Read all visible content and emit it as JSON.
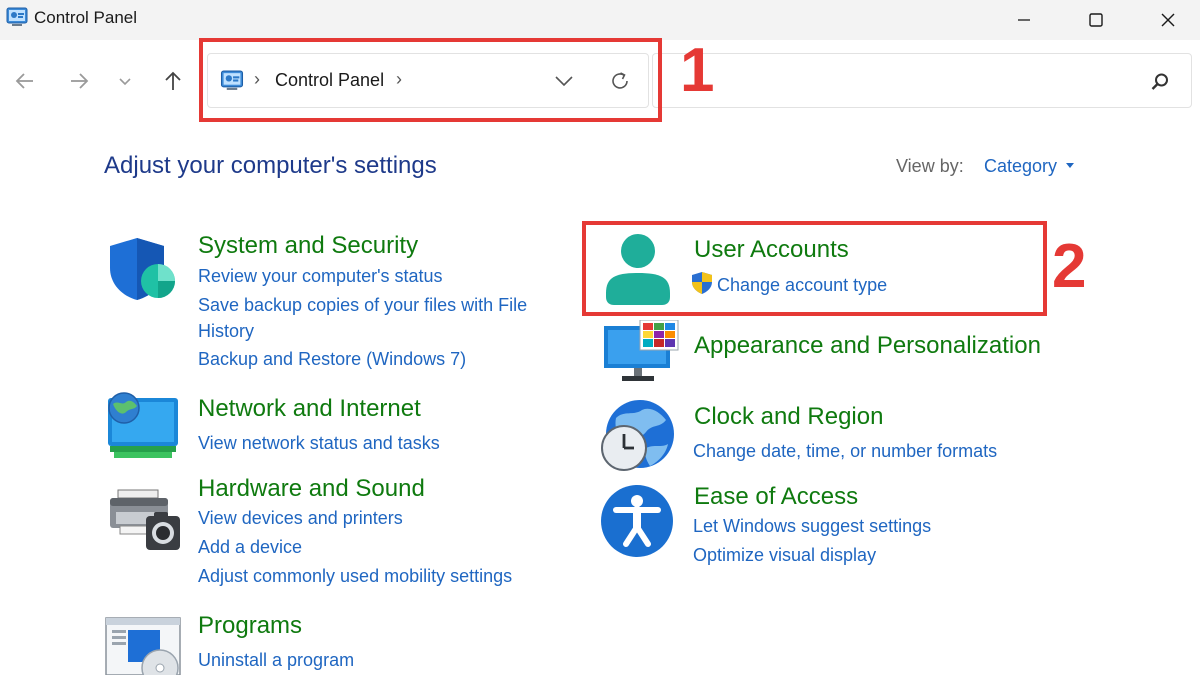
{
  "window": {
    "title": "Control Panel"
  },
  "address": {
    "crumb": "Control Panel",
    "separator": "›"
  },
  "callouts": {
    "one": "1",
    "two": "2"
  },
  "page": {
    "heading": "Adjust your computer's settings",
    "view_by_label": "View by:",
    "view_by_value": "Category"
  },
  "categories": {
    "system_security": {
      "title": "System and Security",
      "links": [
        "Review your computer's status",
        "Save backup copies of your files with File",
        "History",
        "Backup and Restore (Windows 7)"
      ]
    },
    "network": {
      "title": "Network and Internet",
      "links": [
        "View network status and tasks"
      ]
    },
    "hardware": {
      "title": "Hardware and Sound",
      "links": [
        "View devices and printers",
        "Add a device",
        "Adjust commonly used mobility settings"
      ]
    },
    "programs": {
      "title": "Programs",
      "links": [
        "Uninstall a program"
      ]
    },
    "user_accounts": {
      "title": "User Accounts",
      "links": [
        "Change account type"
      ]
    },
    "appearance": {
      "title": "Appearance and Personalization",
      "links": []
    },
    "clock": {
      "title": "Clock and Region",
      "links": [
        "Change date, time, or number formats"
      ]
    },
    "ease": {
      "title": "Ease of Access",
      "links": [
        "Let Windows suggest settings",
        "Optimize visual display"
      ]
    }
  },
  "icons": {
    "app": "control-panel-icon",
    "minimize": "minimize-icon",
    "maximize": "maximize-icon",
    "close": "close-icon",
    "back": "arrow-left-icon",
    "forward": "arrow-right-icon",
    "recent": "chevron-down-icon",
    "up": "arrow-up-icon",
    "refresh": "refresh-icon",
    "search": "search-icon",
    "shield": "uac-shield-icon"
  },
  "colors": {
    "link": "#1f66c1",
    "category_title": "#0f7a0f",
    "heading": "#1e3a8a",
    "callout": "#e53935"
  }
}
